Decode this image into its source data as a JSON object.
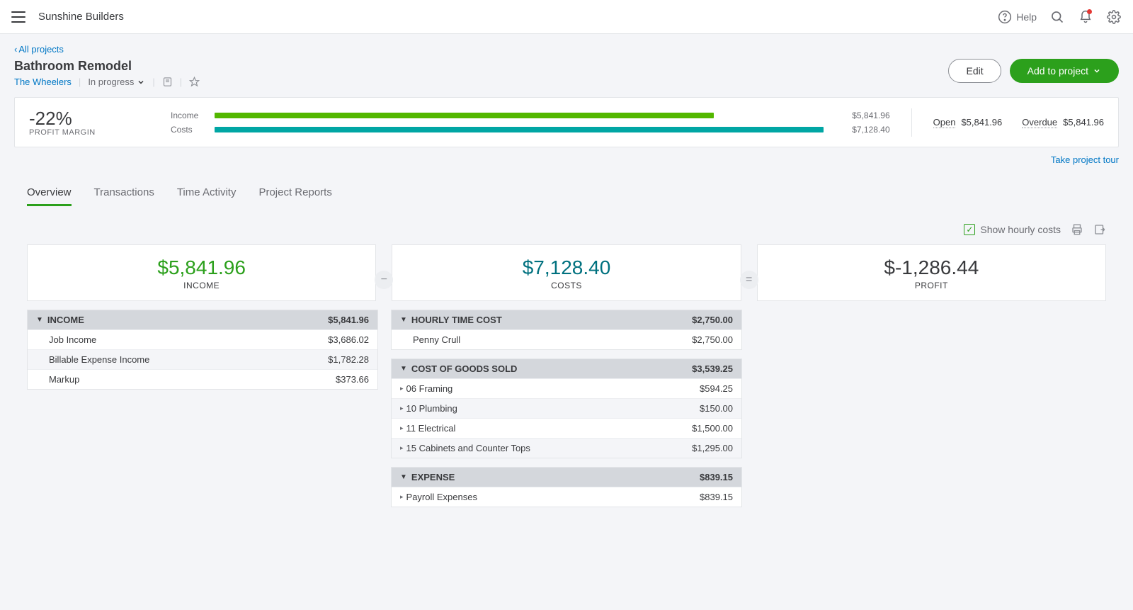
{
  "topbar": {
    "company": "Sunshine Builders",
    "help_label": "Help"
  },
  "breadcrumb": {
    "back_label": "All projects"
  },
  "project": {
    "title": "Bathroom Remodel",
    "customer": "The Wheelers",
    "status": "In progress"
  },
  "actions": {
    "edit": "Edit",
    "add": "Add to project"
  },
  "summary": {
    "margin_pct": "-22%",
    "margin_label": "PROFIT MARGIN",
    "income_label": "Income",
    "costs_label": "Costs",
    "income_value": "$5,841.96",
    "costs_value": "$7,128.40",
    "open_label": "Open",
    "open_value": "$5,841.96",
    "overdue_label": "Overdue",
    "overdue_value": "$5,841.96"
  },
  "tour_link": "Take project tour",
  "tabs": {
    "overview": "Overview",
    "transactions": "Transactions",
    "time": "Time Activity",
    "reports": "Project Reports"
  },
  "controls": {
    "hourly_label": "Show hourly costs"
  },
  "cards": {
    "income_value": "$5,841.96",
    "income_label": "INCOME",
    "costs_value": "$7,128.40",
    "costs_label": "COSTS",
    "profit_value": "$-1,286.44",
    "profit_label": "PROFIT"
  },
  "income_section": {
    "header": "INCOME",
    "total": "$5,841.96",
    "rows": [
      {
        "label": "Job Income",
        "value": "$3,686.02",
        "alt": false
      },
      {
        "label": "Billable Expense Income",
        "value": "$1,782.28",
        "alt": true
      },
      {
        "label": "Markup",
        "value": "$373.66",
        "alt": false
      }
    ]
  },
  "hourly_section": {
    "header": "HOURLY TIME COST",
    "total": "$2,750.00",
    "rows": [
      {
        "label": "Penny Crull",
        "value": "$2,750.00",
        "alt": false
      }
    ]
  },
  "cogs_section": {
    "header": "COST OF GOODS SOLD",
    "total": "$3,539.25",
    "rows": [
      {
        "label": "06 Framing",
        "value": "$594.25",
        "alt": false
      },
      {
        "label": "10 Plumbing",
        "value": "$150.00",
        "alt": true
      },
      {
        "label": "11 Electrical",
        "value": "$1,500.00",
        "alt": false
      },
      {
        "label": "15 Cabinets and Counter Tops",
        "value": "$1,295.00",
        "alt": true
      }
    ]
  },
  "expense_section": {
    "header": "EXPENSE",
    "total": "$839.15",
    "rows": [
      {
        "label": "Payroll Expenses",
        "value": "$839.15",
        "alt": false
      }
    ]
  }
}
